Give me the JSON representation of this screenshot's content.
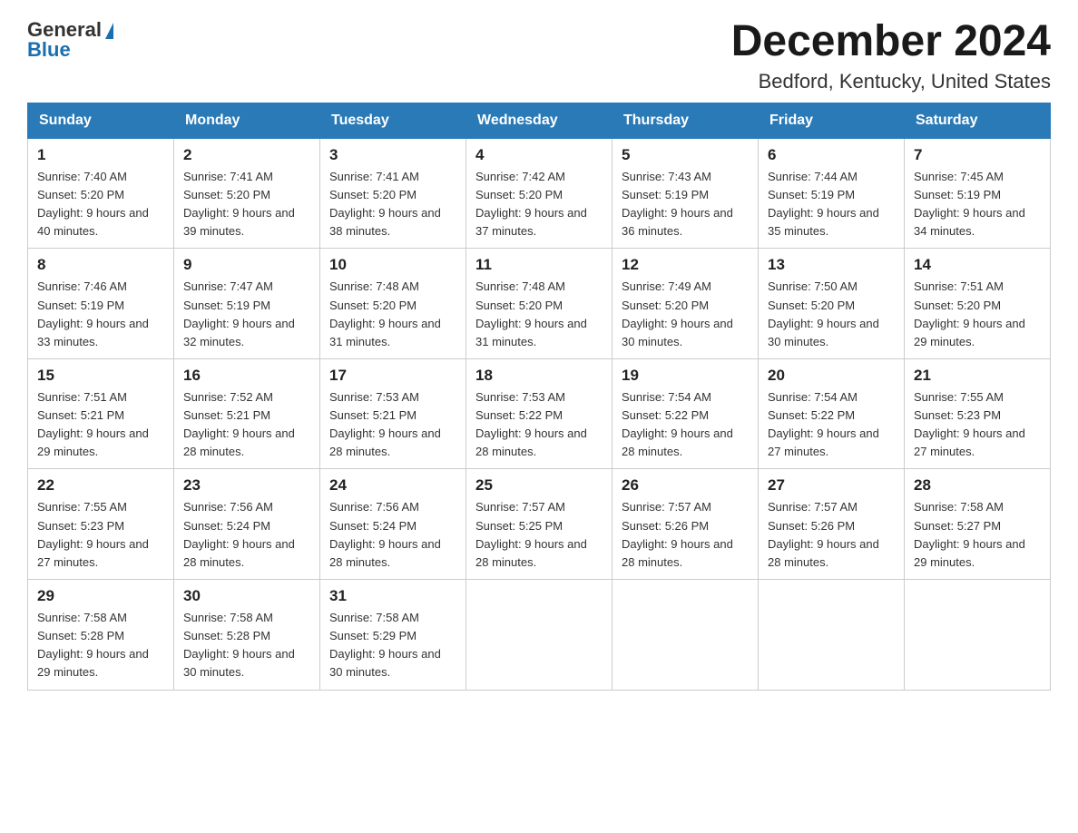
{
  "logo": {
    "text_general": "General",
    "text_blue": "Blue",
    "aria": "GeneralBlue logo"
  },
  "header": {
    "month_year": "December 2024",
    "location": "Bedford, Kentucky, United States"
  },
  "days_of_week": [
    "Sunday",
    "Monday",
    "Tuesday",
    "Wednesday",
    "Thursday",
    "Friday",
    "Saturday"
  ],
  "weeks": [
    [
      {
        "day": "1",
        "sunrise": "Sunrise: 7:40 AM",
        "sunset": "Sunset: 5:20 PM",
        "daylight": "Daylight: 9 hours and 40 minutes."
      },
      {
        "day": "2",
        "sunrise": "Sunrise: 7:41 AM",
        "sunset": "Sunset: 5:20 PM",
        "daylight": "Daylight: 9 hours and 39 minutes."
      },
      {
        "day": "3",
        "sunrise": "Sunrise: 7:41 AM",
        "sunset": "Sunset: 5:20 PM",
        "daylight": "Daylight: 9 hours and 38 minutes."
      },
      {
        "day": "4",
        "sunrise": "Sunrise: 7:42 AM",
        "sunset": "Sunset: 5:20 PM",
        "daylight": "Daylight: 9 hours and 37 minutes."
      },
      {
        "day": "5",
        "sunrise": "Sunrise: 7:43 AM",
        "sunset": "Sunset: 5:19 PM",
        "daylight": "Daylight: 9 hours and 36 minutes."
      },
      {
        "day": "6",
        "sunrise": "Sunrise: 7:44 AM",
        "sunset": "Sunset: 5:19 PM",
        "daylight": "Daylight: 9 hours and 35 minutes."
      },
      {
        "day": "7",
        "sunrise": "Sunrise: 7:45 AM",
        "sunset": "Sunset: 5:19 PM",
        "daylight": "Daylight: 9 hours and 34 minutes."
      }
    ],
    [
      {
        "day": "8",
        "sunrise": "Sunrise: 7:46 AM",
        "sunset": "Sunset: 5:19 PM",
        "daylight": "Daylight: 9 hours and 33 minutes."
      },
      {
        "day": "9",
        "sunrise": "Sunrise: 7:47 AM",
        "sunset": "Sunset: 5:19 PM",
        "daylight": "Daylight: 9 hours and 32 minutes."
      },
      {
        "day": "10",
        "sunrise": "Sunrise: 7:48 AM",
        "sunset": "Sunset: 5:20 PM",
        "daylight": "Daylight: 9 hours and 31 minutes."
      },
      {
        "day": "11",
        "sunrise": "Sunrise: 7:48 AM",
        "sunset": "Sunset: 5:20 PM",
        "daylight": "Daylight: 9 hours and 31 minutes."
      },
      {
        "day": "12",
        "sunrise": "Sunrise: 7:49 AM",
        "sunset": "Sunset: 5:20 PM",
        "daylight": "Daylight: 9 hours and 30 minutes."
      },
      {
        "day": "13",
        "sunrise": "Sunrise: 7:50 AM",
        "sunset": "Sunset: 5:20 PM",
        "daylight": "Daylight: 9 hours and 30 minutes."
      },
      {
        "day": "14",
        "sunrise": "Sunrise: 7:51 AM",
        "sunset": "Sunset: 5:20 PM",
        "daylight": "Daylight: 9 hours and 29 minutes."
      }
    ],
    [
      {
        "day": "15",
        "sunrise": "Sunrise: 7:51 AM",
        "sunset": "Sunset: 5:21 PM",
        "daylight": "Daylight: 9 hours and 29 minutes."
      },
      {
        "day": "16",
        "sunrise": "Sunrise: 7:52 AM",
        "sunset": "Sunset: 5:21 PM",
        "daylight": "Daylight: 9 hours and 28 minutes."
      },
      {
        "day": "17",
        "sunrise": "Sunrise: 7:53 AM",
        "sunset": "Sunset: 5:21 PM",
        "daylight": "Daylight: 9 hours and 28 minutes."
      },
      {
        "day": "18",
        "sunrise": "Sunrise: 7:53 AM",
        "sunset": "Sunset: 5:22 PM",
        "daylight": "Daylight: 9 hours and 28 minutes."
      },
      {
        "day": "19",
        "sunrise": "Sunrise: 7:54 AM",
        "sunset": "Sunset: 5:22 PM",
        "daylight": "Daylight: 9 hours and 28 minutes."
      },
      {
        "day": "20",
        "sunrise": "Sunrise: 7:54 AM",
        "sunset": "Sunset: 5:22 PM",
        "daylight": "Daylight: 9 hours and 27 minutes."
      },
      {
        "day": "21",
        "sunrise": "Sunrise: 7:55 AM",
        "sunset": "Sunset: 5:23 PM",
        "daylight": "Daylight: 9 hours and 27 minutes."
      }
    ],
    [
      {
        "day": "22",
        "sunrise": "Sunrise: 7:55 AM",
        "sunset": "Sunset: 5:23 PM",
        "daylight": "Daylight: 9 hours and 27 minutes."
      },
      {
        "day": "23",
        "sunrise": "Sunrise: 7:56 AM",
        "sunset": "Sunset: 5:24 PM",
        "daylight": "Daylight: 9 hours and 28 minutes."
      },
      {
        "day": "24",
        "sunrise": "Sunrise: 7:56 AM",
        "sunset": "Sunset: 5:24 PM",
        "daylight": "Daylight: 9 hours and 28 minutes."
      },
      {
        "day": "25",
        "sunrise": "Sunrise: 7:57 AM",
        "sunset": "Sunset: 5:25 PM",
        "daylight": "Daylight: 9 hours and 28 minutes."
      },
      {
        "day": "26",
        "sunrise": "Sunrise: 7:57 AM",
        "sunset": "Sunset: 5:26 PM",
        "daylight": "Daylight: 9 hours and 28 minutes."
      },
      {
        "day": "27",
        "sunrise": "Sunrise: 7:57 AM",
        "sunset": "Sunset: 5:26 PM",
        "daylight": "Daylight: 9 hours and 28 minutes."
      },
      {
        "day": "28",
        "sunrise": "Sunrise: 7:58 AM",
        "sunset": "Sunset: 5:27 PM",
        "daylight": "Daylight: 9 hours and 29 minutes."
      }
    ],
    [
      {
        "day": "29",
        "sunrise": "Sunrise: 7:58 AM",
        "sunset": "Sunset: 5:28 PM",
        "daylight": "Daylight: 9 hours and 29 minutes."
      },
      {
        "day": "30",
        "sunrise": "Sunrise: 7:58 AM",
        "sunset": "Sunset: 5:28 PM",
        "daylight": "Daylight: 9 hours and 30 minutes."
      },
      {
        "day": "31",
        "sunrise": "Sunrise: 7:58 AM",
        "sunset": "Sunset: 5:29 PM",
        "daylight": "Daylight: 9 hours and 30 minutes."
      },
      null,
      null,
      null,
      null
    ]
  ]
}
